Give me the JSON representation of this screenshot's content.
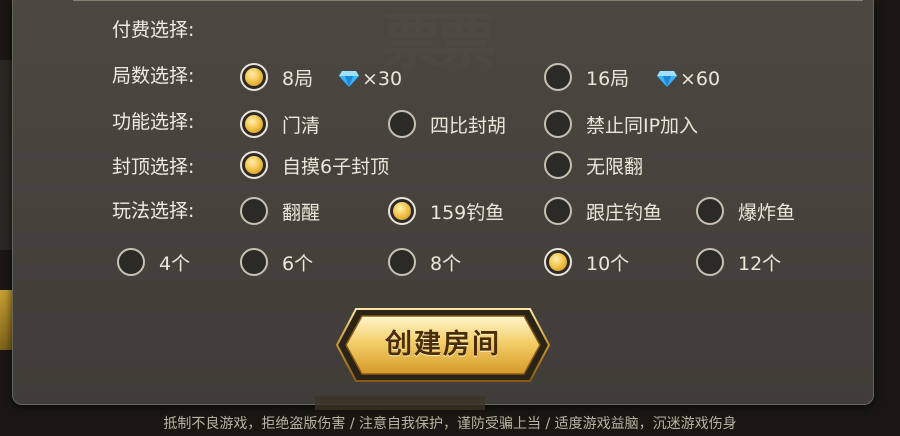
{
  "labels": {
    "payment": "付费选择:",
    "rounds": "局数选择:",
    "function": "功能选择:",
    "cap": "封顶选择:",
    "play": "玩法选择:"
  },
  "rounds": {
    "opt1": {
      "label": "8局",
      "selected": true,
      "cost": "×30"
    },
    "opt2": {
      "label": "16局",
      "selected": false,
      "cost": "×60"
    }
  },
  "function": {
    "opt1": {
      "label": "门清",
      "selected": true
    },
    "opt2": {
      "label": "四比封胡",
      "selected": false
    },
    "opt3": {
      "label": "禁止同IP加入",
      "selected": false
    }
  },
  "cap": {
    "opt1": {
      "label": "自摸6子封顶",
      "selected": true
    },
    "opt2": {
      "label": "无限翻",
      "selected": false
    }
  },
  "play": {
    "opt1": {
      "label": "翻醒",
      "selected": false
    },
    "opt2": {
      "label": "159钓鱼",
      "selected": true
    },
    "opt3": {
      "label": "跟庄钓鱼",
      "selected": false
    },
    "opt4": {
      "label": "爆炸鱼",
      "selected": false
    }
  },
  "count": {
    "opt1": {
      "label": "4个",
      "selected": false
    },
    "opt2": {
      "label": "6个",
      "selected": false
    },
    "opt3": {
      "label": "8个",
      "selected": false
    },
    "opt4": {
      "label": "10个",
      "selected": true
    },
    "opt5": {
      "label": "12个",
      "selected": false
    }
  },
  "create_button": "创建房间",
  "footer": "抵制不良游戏，拒绝盗版伤害 / 注意自我保护，谨防受骗上当 / 适度游戏益脑，沉迷游戏伤身",
  "colors": {
    "dialog": "#45423c",
    "accent_gold": "#f3c54d",
    "text": "#ece6d8",
    "diamond": "#38b6ff"
  },
  "icons": {
    "diamond": "diamond-icon",
    "radio_on": "radio-selected-icon",
    "radio_off": "radio-unselected-icon"
  }
}
